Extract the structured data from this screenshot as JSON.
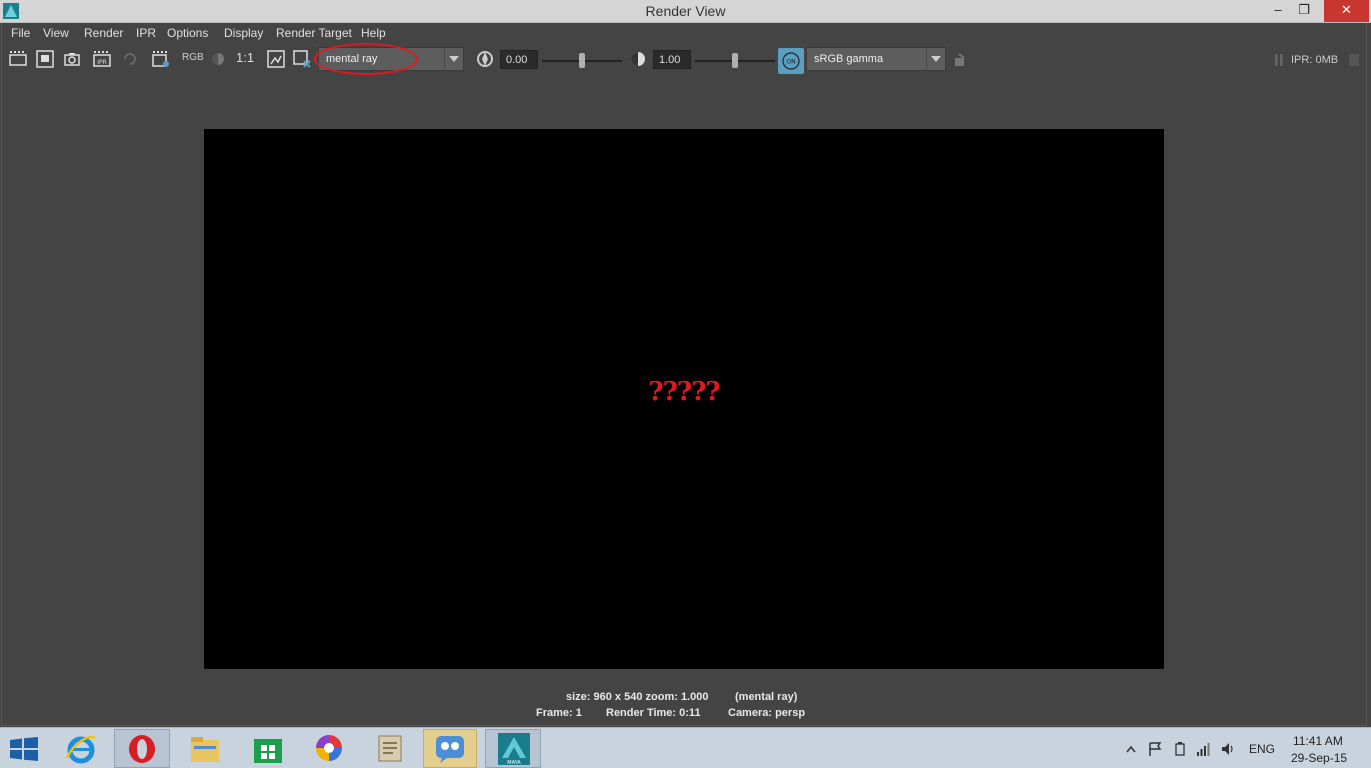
{
  "window": {
    "title": "Render View",
    "controls": {
      "minimize": "–",
      "restore": "❐",
      "close": "✕"
    }
  },
  "menu": [
    "File",
    "View",
    "Render",
    "IPR",
    "Options",
    "Display",
    "Render Target",
    "Help"
  ],
  "toolbar": {
    "rgb_label": "RGB",
    "ratio_label": "1:1",
    "renderer": "mental ray",
    "exposure_value": "0.00",
    "exposure_slider_fraction": 0.5,
    "gamma_value": "1.00",
    "gamma_slider_fraction": 0.5,
    "colorspace_toggle": "ON",
    "view_transform": "sRGB gamma",
    "ipr_memory": "IPR: 0MB"
  },
  "viewport": {
    "overlay_text": "?????"
  },
  "status": {
    "size_zoom": "size: 960 x 540 zoom: 1.000",
    "renderer": "(mental ray)",
    "frame": "Frame: 1",
    "render_time": "Render Time: 0:11",
    "camera": "Camera: persp"
  },
  "taskbar": {
    "apps": [
      "start",
      "internet-explorer",
      "opera",
      "file-explorer",
      "store",
      "chrome-like",
      "notes",
      "people-app",
      "maya"
    ],
    "maya_label": "MAYA",
    "language": "ENG",
    "time": "11:41 AM",
    "date": "29-Sep-15"
  },
  "colors": {
    "annotation": "#e0191f",
    "ui_bg": "#444444",
    "taskbar": "#c9d3de",
    "gamma_button": "#5a9fbf"
  }
}
